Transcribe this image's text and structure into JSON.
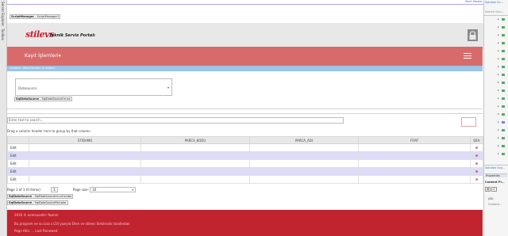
{
  "left_toolbar": {
    "tabs": [
      "Server Explorer",
      "Toolbox"
    ]
  },
  "designer": {
    "master_tag": "Site1.Master",
    "script_manager": {
      "name": "ScriptManager",
      "type": "ScriptManager1"
    },
    "logo_text": "stilevs",
    "portal_title": "Teknik Servis Portalı",
    "nav_item": "Kayıt İşlemleri▾",
    "blue_tag": "Content - MainContent (Custom)",
    "datasource_select": {
      "label": "Datasource:"
    },
    "sql_datasource_1": {
      "name": "SqlDataSource",
      "type": "SqlDataSourceUruns"
    },
    "grid": {
      "search_placeholder": "Enter text to search...",
      "group_panel": "Drag a column header here to group by that column",
      "columns": [
        "",
        "STIDAMO",
        "PARCA_KODU",
        "PARCA_ADI",
        "FIYAT",
        "DEX"
      ],
      "edit_label": "Edit",
      "delete_glyph": "✖",
      "rows": 5,
      "pager_text": "Page 1 of 1 (0 items)",
      "pager_page": "1",
      "page_size_label": "Page size:",
      "page_size_value": "10"
    },
    "sql_datasource_2": {
      "name": "SqlDataSource",
      "type": "SqlDataSourceUrunCombo"
    },
    "sql_datasource_3": {
      "name": "SqlDataSource",
      "type": "SqlDataSourceParcalar"
    },
    "footer": {
      "line1": "2016 © eemsusattri Yazılım",
      "line2": "Bu program ve su Lisa s.Ctli yazıyla Ellen ve stilevs Elektronik tarafından",
      "line3": "Page Hits: ... Last Renewed"
    }
  },
  "right_panel": {
    "header": "Solution Ex...",
    "search_label": "Search Solu...",
    "footer_label1": "Solution Exp...",
    "properties_label": "Properties",
    "content_label": "Content Pl...",
    "id_label": "(ID)",
    "content_value": "Content..."
  },
  "colors": {
    "brand_red": "#cc1f2f",
    "nav_red": "#d76b6b",
    "footer_red": "#c1232f",
    "accent_blue": "#9cc3e8",
    "row_alt": "#dcdcf7"
  }
}
